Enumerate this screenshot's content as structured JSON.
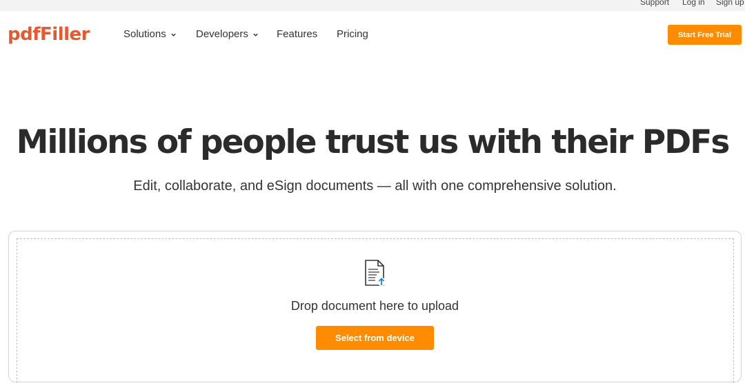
{
  "top_links": {
    "support": "Support",
    "login": "Log in",
    "signup": "Sign up"
  },
  "header": {
    "logo": "pdfFiller",
    "nav": [
      {
        "label": "Solutions",
        "has_dropdown": true
      },
      {
        "label": "Developers",
        "has_dropdown": true
      },
      {
        "label": "Features",
        "has_dropdown": false
      },
      {
        "label": "Pricing",
        "has_dropdown": false
      }
    ],
    "cta": "Start Free Trial"
  },
  "hero": {
    "title": "Millions of people trust us with their PDFs",
    "subtitle": "Edit, collaborate, and eSign documents — all with one comprehensive solution."
  },
  "upload": {
    "icon": "document-upload-icon",
    "drop_text": "Drop document here to upload",
    "button": "Select from device"
  },
  "colors": {
    "brand": "#e4592f",
    "accent": "#ff8c00",
    "upload_arrow": "#1e88c9"
  }
}
